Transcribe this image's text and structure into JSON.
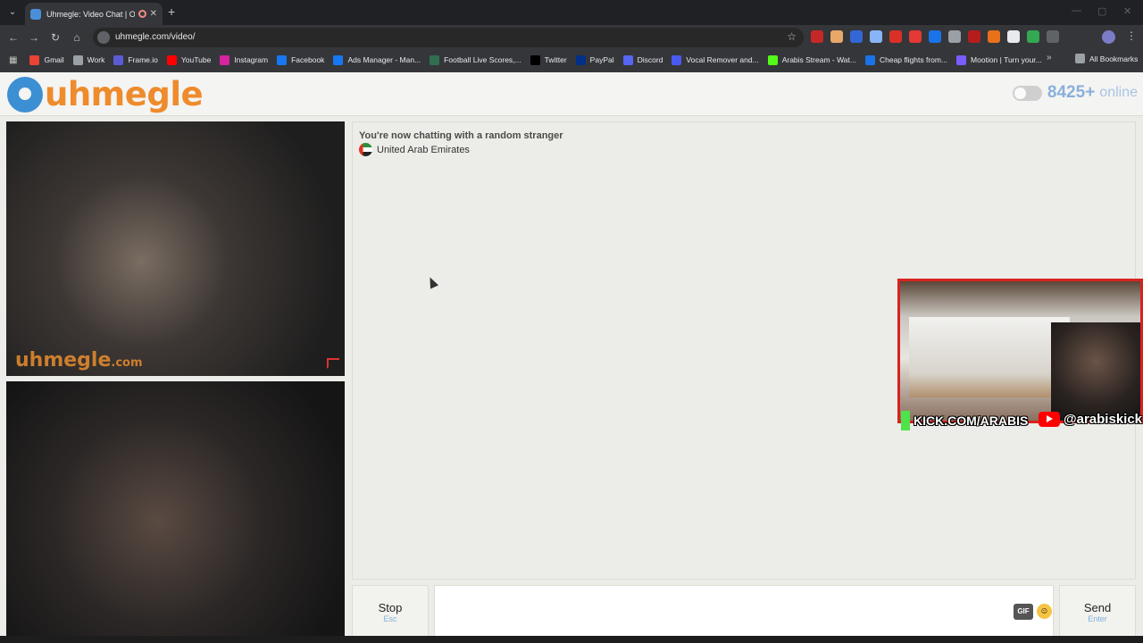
{
  "browser": {
    "tab_title": "Uhmegle: Video Chat | Ome",
    "url": "uhmegle.com/video/",
    "bookmarks": [
      {
        "label": "Gmail",
        "color": "#ea4335"
      },
      {
        "label": "Work",
        "color": "#9aa0a6"
      },
      {
        "label": "Frame.io",
        "color": "#5b5bd6"
      },
      {
        "label": "YouTube",
        "color": "#ff0000"
      },
      {
        "label": "Instagram",
        "color": "#d6249f"
      },
      {
        "label": "Facebook",
        "color": "#1877f2"
      },
      {
        "label": "Ads Manager - Man...",
        "color": "#1877f2"
      },
      {
        "label": "Football Live Scores,...",
        "color": "#2f6f4e"
      },
      {
        "label": "Twitter",
        "color": "#000000"
      },
      {
        "label": "PayPal",
        "color": "#003087"
      },
      {
        "label": "Discord",
        "color": "#5865f2"
      },
      {
        "label": "Vocal Remover and...",
        "color": "#4a5af0"
      },
      {
        "label": "Arabis Stream - Wat...",
        "color": "#53fc18"
      },
      {
        "label": "Cheap flights from...",
        "color": "#1a73e8"
      },
      {
        "label": "Mootion | Turn your...",
        "color": "#7a5cff"
      }
    ],
    "all_bookmarks_label": "All Bookmarks"
  },
  "site": {
    "logo_text": "uhmegle",
    "online_count": "8425+",
    "online_label": "online"
  },
  "video": {
    "watermark_brand": "uhmegle",
    "watermark_tld": ".com"
  },
  "chat": {
    "status_title": "You're now chatting with a random stranger",
    "country": "United Arab Emirates"
  },
  "overlay": {
    "kick_text": "KICK.COM/ARABIS",
    "youtube_text": "@arabiskick"
  },
  "controls": {
    "stop_label": "Stop",
    "stop_hint": "Esc",
    "send_label": "Send",
    "send_hint": "Enter",
    "gif_label": "GIF",
    "message_placeholder": ""
  },
  "colors": {
    "logo_orange": "#ee8b2c",
    "logo_blue": "#3d8fd4",
    "online_blue": "#8ab0dc",
    "overlay_red": "#d8221f",
    "kick_green": "#53fc18"
  }
}
